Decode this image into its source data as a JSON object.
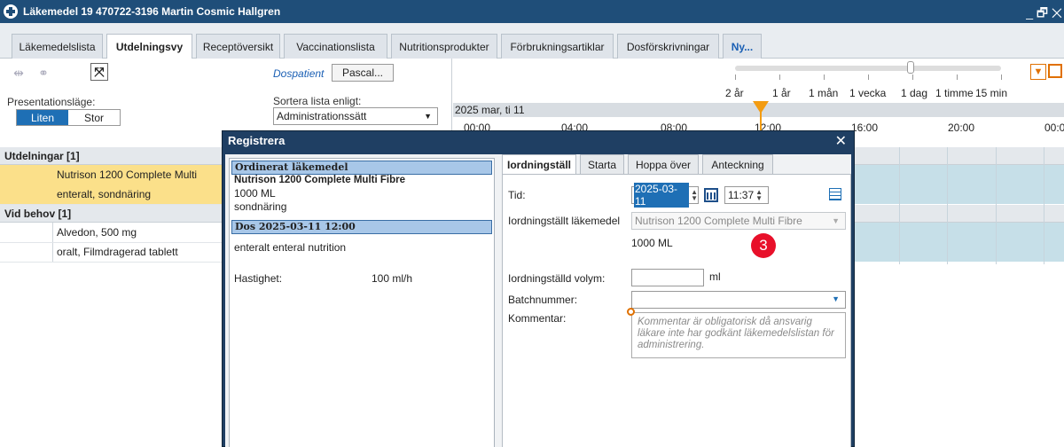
{
  "window": {
    "title": "Läkemedel 19 470722-3196 Martin Cosmic Hallgren",
    "controls": "_ 🗗 ✕"
  },
  "tabs": [
    {
      "label": "Läkemedelslista"
    },
    {
      "label": "Utdelningsvy"
    },
    {
      "label": "Receptöversikt"
    },
    {
      "label": "Vaccinationslista"
    },
    {
      "label": "Nutritionsprodukter"
    },
    {
      "label": "Förbrukningsartiklar"
    },
    {
      "label": "Dosförskrivningar"
    },
    {
      "label": "Ny..."
    }
  ],
  "toolbar": {
    "presentation_label": "Presentationsläge:",
    "size_small": "Liten",
    "size_large": "Stor",
    "dospatient_label": "Dospatient",
    "pascal_button": "Pascal...",
    "sort_label": "Sortera lista enligt:",
    "sort_value": "Administrationssätt"
  },
  "timeline": {
    "zoom_labels": [
      "2 år",
      "1 år",
      "1 mån",
      "1 vecka",
      "1 dag",
      "1 timme",
      "15 min"
    ],
    "date": "2025 mar, ti 11",
    "hours": [
      "00:00",
      "04:00",
      "08:00",
      "12:00",
      "16:00",
      "20:00",
      "00:0"
    ]
  },
  "list": {
    "group1": "Utdelningar [1]",
    "item1_name": "Nutrison 1200  Complete Multi Fibre",
    "item1_route": "enteralt, sondnäring",
    "group2": "Vid behov [1]",
    "item2_name": "Alvedon, 500 mg",
    "item2_route": "oralt, Filmdragerad tablett"
  },
  "dialog": {
    "title": "Registrera",
    "close": "✕",
    "ordered_header": "Ordinerat läkemedel",
    "ordered_name": "Nutrison 1200  Complete Multi Fibre",
    "ordered_volume": "1000 ML",
    "ordered_type": "sondnäring",
    "dose_header": "Dos 2025-03-11 12:00",
    "dose_route": "enteralt enteral nutrition",
    "speed_label": "Hastighet:",
    "speed_value": "100  ml/h",
    "tabs": [
      {
        "label": "Iordningställ"
      },
      {
        "label": "Starta"
      },
      {
        "label": "Hoppa över"
      },
      {
        "label": "Anteckning"
      }
    ],
    "time_label": "Tid:",
    "date_value": "2025-03-11",
    "time_value": "11:37",
    "prepared_med_label": "Iordningställt läkemedel",
    "prepared_med_value": "Nutrison 1200  Complete Multi Fibre",
    "volume_display": "1000 ML",
    "badge": "3",
    "prepared_volume_label": "Iordningställd volym:",
    "volume_unit": "ml",
    "batch_label": "Batchnummer:",
    "comment_label": "Kommentar:",
    "comment_placeholder": "Kommentar är obligatorisk då ansvarig läkare inte har godkänt läkemedelslistan för administrering."
  }
}
